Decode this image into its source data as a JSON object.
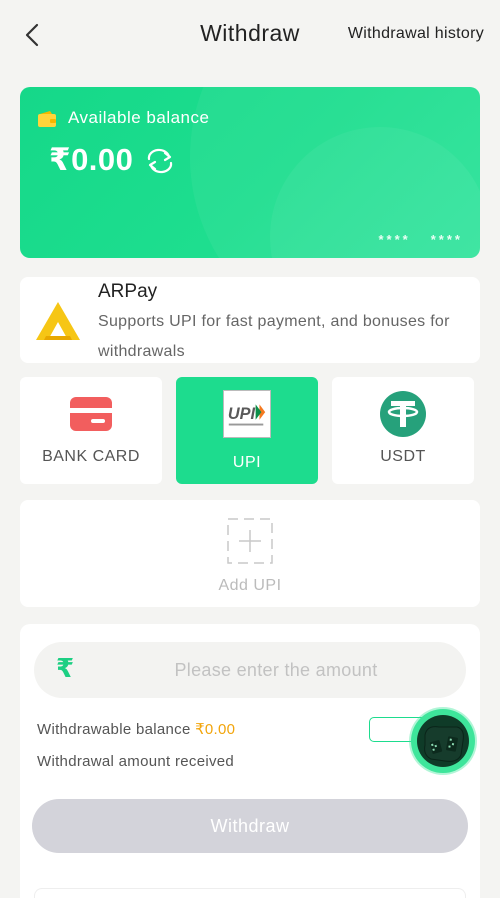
{
  "header": {
    "title": "Withdraw",
    "history_label": "Withdrawal history",
    "back_icon": "chevron-left-icon"
  },
  "balance_card": {
    "label": "Available balance",
    "amount": "₹0.00",
    "masked_left": "****",
    "masked_right": "****",
    "wallet_icon": "wallet-icon",
    "refresh_icon": "refresh-icon"
  },
  "arpay": {
    "name": "ARPay",
    "description": "Supports UPI for fast payment, and bonuses for withdrawals"
  },
  "methods": [
    {
      "label": "BANK CARD",
      "icon": "bank-card-icon",
      "active": false
    },
    {
      "label": "UPI",
      "icon": "upi-logo-icon",
      "active": true
    },
    {
      "label": "USDT",
      "icon": "tether-icon",
      "active": false
    }
  ],
  "add_upi": {
    "label": "Add UPI",
    "icon": "plus-icon"
  },
  "form": {
    "currency_symbol": "₹",
    "amount_placeholder": "Please enter the amount",
    "amount_value": "",
    "withdrawable_label": "Withdrawable balance ",
    "withdrawable_value": "₹0.00",
    "received_label": "Withdrawal amount received",
    "withdraw_button": "Withdraw"
  },
  "colors": {
    "primary_green": "#1ddc8e",
    "highlight_orange": "#f2a50c",
    "disabled_button": "#d3d3da",
    "background": "#f4f4f2"
  }
}
